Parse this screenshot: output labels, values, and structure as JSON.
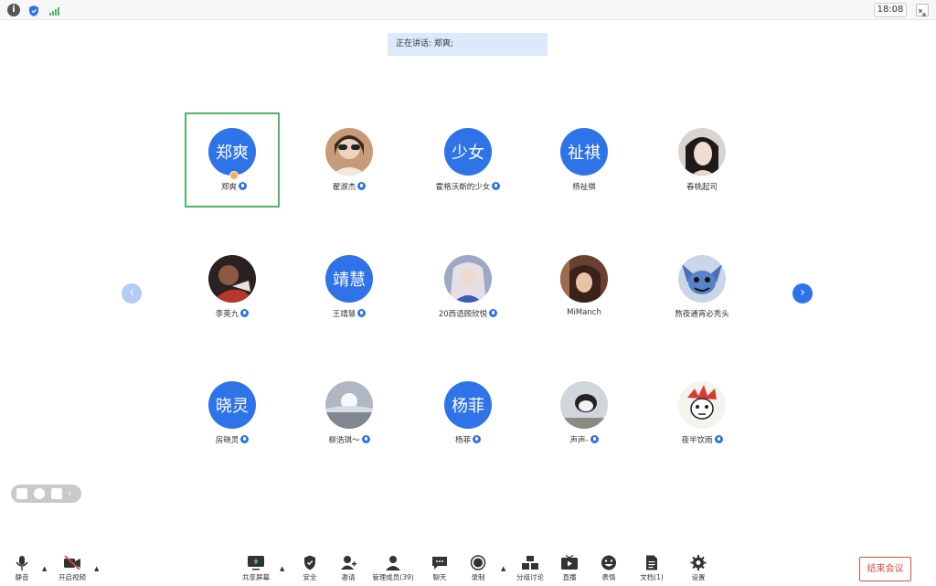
{
  "topbar": {
    "time": "18:08"
  },
  "speaking_banner": "正在讲话: 郑爽;",
  "participants": [
    {
      "name": "郑爽",
      "avatar_text": "郑爽",
      "active": true
    },
    {
      "name": "翟淑杰",
      "avatar_text": ""
    },
    {
      "name": "霍格沃斯的少女",
      "avatar_text": "少女"
    },
    {
      "name": "杨祉祺",
      "avatar_text": "祉祺"
    },
    {
      "name": "春桃起司",
      "avatar_text": ""
    },
    {
      "name": "李英九",
      "avatar_text": ""
    },
    {
      "name": "王靖慧",
      "avatar_text": "靖慧"
    },
    {
      "name": "20西语顾欣悦",
      "avatar_text": ""
    },
    {
      "name": "MiManch",
      "avatar_text": ""
    },
    {
      "name": "熬夜通宵必秃头",
      "avatar_text": ""
    },
    {
      "name": "房晓灵",
      "avatar_text": "晓灵"
    },
    {
      "name": "柳浩琪～",
      "avatar_text": ""
    },
    {
      "name": "杨菲",
      "avatar_text": "杨菲"
    },
    {
      "name": "声声-",
      "avatar_text": ""
    },
    {
      "name": "夜半饮雨",
      "avatar_text": ""
    }
  ],
  "toolbar": {
    "mute": "静音",
    "video": "开启视频",
    "share": "共享屏幕",
    "security": "安全",
    "invite": "邀请",
    "members": "管理成员(39)",
    "chat": "聊天",
    "record": "录制",
    "breakout": "分组讨论",
    "live": "直播",
    "reactions": "表情",
    "docs": "文档(1)",
    "settings": "设置",
    "end": "结束会议"
  },
  "colors": {
    "accent": "#2e73e8",
    "active_border": "#4cb866",
    "end": "#e04b3c"
  }
}
